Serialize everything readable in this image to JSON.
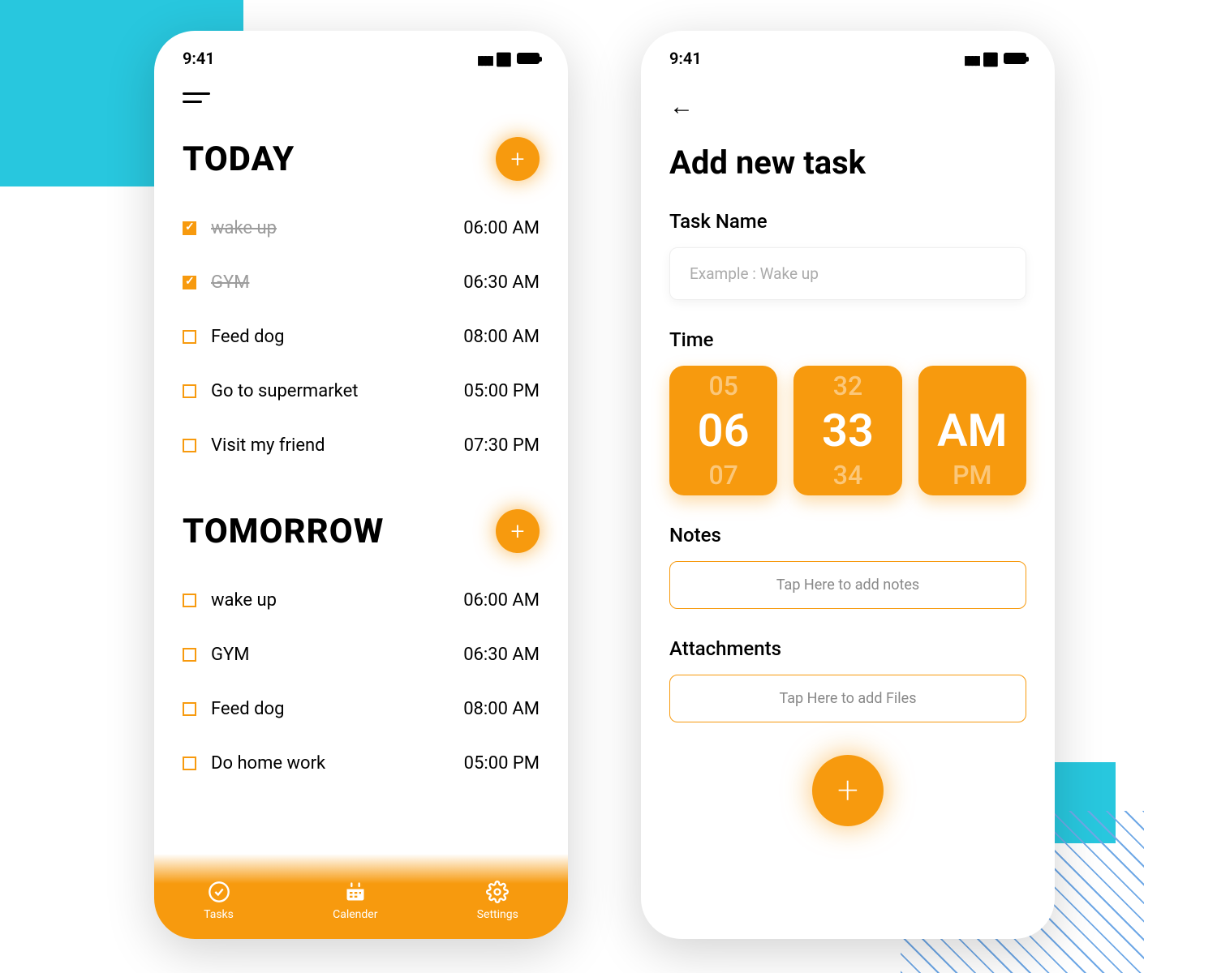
{
  "status": {
    "time": "9:41"
  },
  "left": {
    "sections": [
      {
        "title": "TODAY",
        "tasks": [
          {
            "label": "wake up",
            "time": "06:00 AM",
            "done": true
          },
          {
            "label": "GYM",
            "time": "06:30 AM",
            "done": true
          },
          {
            "label": "Feed dog",
            "time": "08:00 AM",
            "done": false
          },
          {
            "label": "Go to supermarket",
            "time": "05:00 PM",
            "done": false
          },
          {
            "label": "Visit my friend",
            "time": "07:30 PM",
            "done": false
          }
        ]
      },
      {
        "title": "TOMORROW",
        "tasks": [
          {
            "label": "wake up",
            "time": "06:00 AM",
            "done": false
          },
          {
            "label": "GYM",
            "time": "06:30 AM",
            "done": false
          },
          {
            "label": "Feed dog",
            "time": "08:00 AM",
            "done": false
          },
          {
            "label": "Do home work",
            "time": "05:00 PM",
            "done": false
          }
        ]
      }
    ],
    "nav": {
      "tasks": "Tasks",
      "calendar": "Calender",
      "settings": "Settings"
    }
  },
  "right": {
    "title": "Add new task",
    "taskNameLabel": "Task Name",
    "taskNamePlaceholder": "Example : Wake up",
    "timeLabel": "Time",
    "time": {
      "hourPrev": "05",
      "hour": "06",
      "hourNext": "07",
      "minPrev": "32",
      "min": "33",
      "minNext": "34",
      "ampm": "AM",
      "ampmNext": "PM"
    },
    "notesLabel": "Notes",
    "notesPlaceholder": "Tap Here to add notes",
    "attachLabel": "Attachments",
    "attachPlaceholder": "Tap Here to add Files"
  }
}
